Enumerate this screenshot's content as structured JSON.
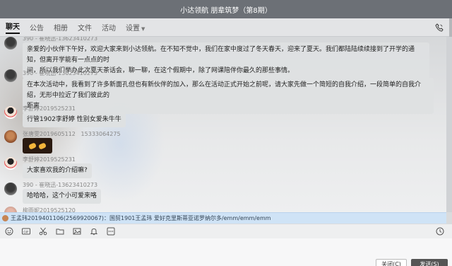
{
  "window": {
    "title": "小达领航 朋辈筑梦（第8期）"
  },
  "tabs": [
    {
      "label": "聊天"
    },
    {
      "label": "公告"
    },
    {
      "label": "相册"
    },
    {
      "label": "文件"
    },
    {
      "label": "活动"
    },
    {
      "label": "设置"
    }
  ],
  "messages": [
    {
      "sender": "390 - 崔晓迅-13623410273",
      "text_lines": [
        "亲爱的小伙伴下午好，欢迎大家来到小达领航。在不知不觉中，我们在家中度过了冬天春天，迎来了夏天。我们都陆陆续续接到了开学的通知，但离开学能有一点点的时",
        "间，所以我们举办此次夏天茶话会，聊一聊，在这个假期中，除了网课陪伴你最久的那些事情。"
      ]
    },
    {
      "sender": "390 - 崔晓迅-13623410273",
      "text_lines": [
        "在本次活动中，我看到了许多新面孔但也有新伙伴的加入，那么在活动正式开始之前呢，请大家先做一个简短的自我介绍，一段简单的自我介绍，无形中拉近了我们彼此的",
        "距离"
      ]
    },
    {
      "sender": "李舒婷2019525231",
      "text_lines": [
        "行管1902李舒婷 性别女爱朱牛牛"
      ]
    },
    {
      "sender": "张唐雯2019605112",
      "sender_extra": "15333064275",
      "sticker": true
    },
    {
      "sender": "李舒婷2019525231",
      "text_lines": [
        "大家喜欢我的介绍嘛?"
      ]
    },
    {
      "sender": "390 - 崔晓迅-13623410273",
      "text_lines": [
        "哈哈哈，这个小可爱来咯"
      ]
    },
    {
      "sender": "柳雨妮2019525120",
      "text_lines": []
    }
  ],
  "at_bar": {
    "text": "王孟玮2019401106(2569920067)：国贸1901王孟玮 爱好克里斯蒂亚诺罗纳尔多/emm/emm/emm"
  },
  "buttons": {
    "close": "关闭(C)",
    "send": "发送(S)"
  }
}
